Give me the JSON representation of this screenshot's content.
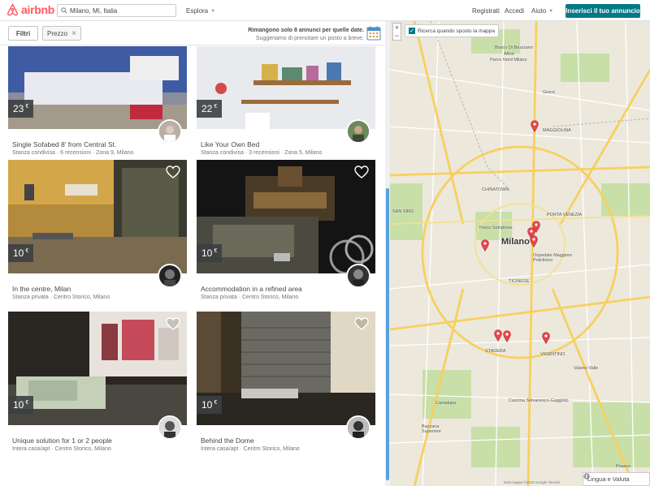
{
  "header": {
    "brand": "airbnb",
    "search_value": "Milano, MI, Italia",
    "explore_label": "Esplora",
    "nav": {
      "register": "Registrati",
      "login": "Accedi",
      "help": "Aiuto"
    },
    "host_button": "Inserisci il tuo annuncio"
  },
  "filters": {
    "filters_button": "Filtri",
    "price_chip": "Prezzo",
    "notice_bold": "Rimangono solo 8 annunci per quelle date.",
    "notice_sub": "Suggeriamo di prenotare un posto a breve."
  },
  "listings": [
    {
      "price": "23",
      "currency": "€",
      "title": "Single Sofabed 8' from Central St.",
      "subtitle": "Stanza condivisa · 6 recensioni · Zona 9, Milano"
    },
    {
      "price": "22",
      "currency": "€",
      "title": "Like Your Own Bed",
      "subtitle": "Stanza condivisa · 3 recensioni · Zona 5, Milano"
    },
    {
      "price": "10",
      "currency": "€",
      "title": "In the centre, Milan",
      "subtitle": "Stanza privata · Centro Storico, Milano"
    },
    {
      "price": "10",
      "currency": "€",
      "title": "Accommodation in a refined area",
      "subtitle": "Stanza privata · Centro Storico, Milano"
    },
    {
      "price": "10",
      "currency": "€",
      "title": "Unique solution for 1 or 2 people",
      "subtitle": "Intera casa/apt · Centro Storico, Milano"
    },
    {
      "price": "10",
      "currency": "€",
      "title": "Behind the Dome",
      "subtitle": "Intera casa/apt · Centro Storico, Milano"
    }
  ],
  "map": {
    "search_when_move": "Ricerca quando sposto la mappa",
    "city": "Milano",
    "labels": {
      "bosco": "Bosco Di Bruzzano",
      "affori": "Affori",
      "parco_nord": "Parco Nord Milano",
      "greco": "Greco",
      "maggiolina": "MAGGIOLINA",
      "chinatown": "CHINATOWN",
      "san_siro": "SAN SIRO",
      "sempione": "Parco Sempione",
      "porta_venezia": "PORTA VENEZIA",
      "ospedale": "Ospedale Maggiore Policlinico",
      "ticinese": "TICINESE",
      "stadera": "STADERA",
      "vigentino": "VIGENTINO",
      "vaiano": "Vaiano Valle",
      "cantalupa": "Cantalupa",
      "cascina": "Cascina Selvanesco-Gaggiolo",
      "bazzana": "Bazzana Superiore",
      "poasco": "Poasco"
    },
    "footer": "Dati mappa ©2015 Google   Termini"
  },
  "footer": {
    "language_currency": "Lingua e Valuta"
  },
  "colors": {
    "brand": "#ff5a5f",
    "host_button": "#007a87",
    "pin": "#e8464b"
  }
}
